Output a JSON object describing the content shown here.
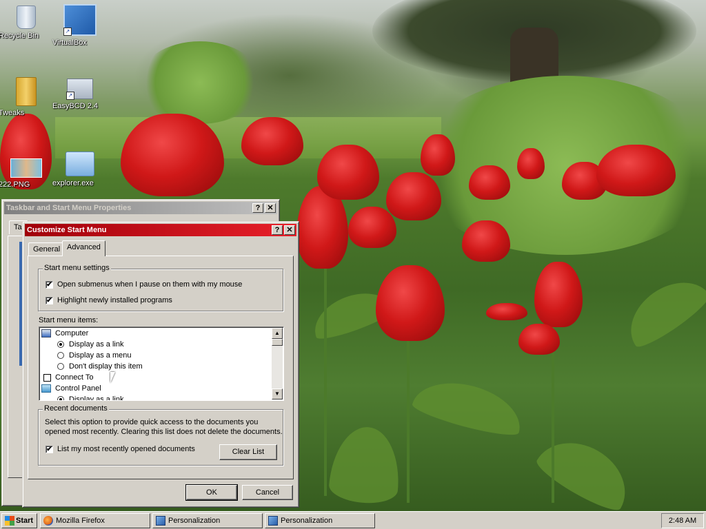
{
  "desktop": {
    "icons": [
      {
        "label": "Recycle Bin",
        "icon": "recycle-bin-icon"
      },
      {
        "label": "VirtualBox",
        "icon": "virtualbox-icon"
      },
      {
        "label": "Tweaks",
        "icon": "folder-icon"
      },
      {
        "label": "EasyBCD 2.4",
        "icon": "easybcd-icon"
      },
      {
        "label": "222.PNG",
        "icon": "image-file-icon"
      },
      {
        "label": "explorer.exe",
        "icon": "computer-icon"
      }
    ]
  },
  "back_window": {
    "title": "Taskbar and Start Menu Properties",
    "help_btn": "?",
    "close_btn": "✕",
    "tab_stub": "Ta"
  },
  "dialog": {
    "title": "Customize Start Menu",
    "help_btn": "?",
    "close_btn": "✕",
    "tabs": [
      {
        "label": "General"
      },
      {
        "label": "Advanced"
      }
    ],
    "settings_group": {
      "legend": "Start menu settings",
      "options": [
        {
          "label": "Open submenus when I pause on them with my mouse",
          "checked": true
        },
        {
          "label": "Highlight newly installed programs",
          "checked": true
        }
      ]
    },
    "items_label": "Start menu items:",
    "items": [
      {
        "label": "Computer",
        "kind": "header",
        "icon": "computer-icon"
      },
      {
        "label": "Display as a link",
        "kind": "radio",
        "selected": true
      },
      {
        "label": "Display as a menu",
        "kind": "radio",
        "selected": false
      },
      {
        "label": "Don't display this item",
        "kind": "radio",
        "selected": false
      },
      {
        "label": "Connect To",
        "kind": "checkbox",
        "checked": false
      },
      {
        "label": "Control Panel",
        "kind": "header",
        "icon": "control-panel-icon"
      },
      {
        "label": "Display as a link",
        "kind": "radio",
        "selected": true
      }
    ],
    "recent_group": {
      "legend": "Recent documents",
      "description_line1": "Select this option to provide quick access to the documents you",
      "description_line2": "opened most recently.  Clearing this list does not delete the documents.",
      "list_option": {
        "label": "List my most recently opened documents",
        "checked": true
      },
      "clear_button": "Clear List"
    },
    "ok_button": "OK",
    "cancel_button": "Cancel",
    "check_mark": "✔"
  },
  "taskbar": {
    "start_label": "Start",
    "tasks": [
      {
        "label": "Mozilla Firefox",
        "icon": "firefox-icon"
      },
      {
        "label": "Personalization",
        "icon": "personalization-icon"
      },
      {
        "label": "Personalization",
        "icon": "personalization-icon"
      }
    ],
    "clock": "2:48 AM"
  },
  "colors": {
    "active_title": "#a0000a",
    "inactive_title": "#808080",
    "face": "#d4d0c8"
  }
}
